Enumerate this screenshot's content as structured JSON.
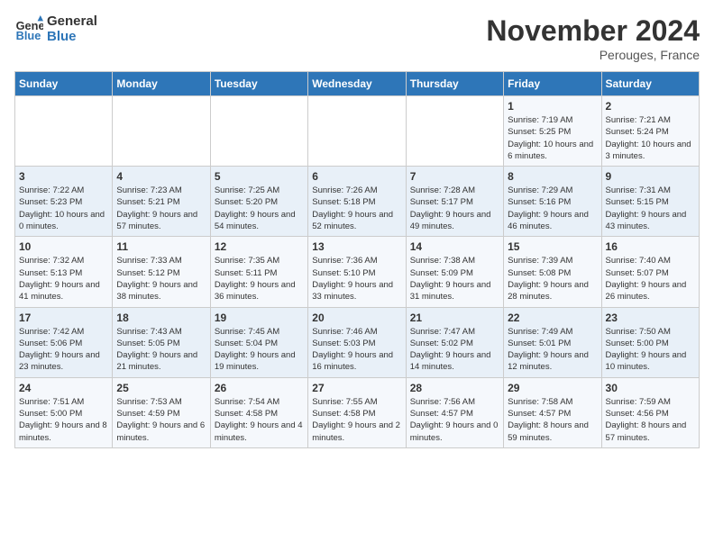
{
  "header": {
    "logo_line1": "General",
    "logo_line2": "Blue",
    "month_title": "November 2024",
    "location": "Perouges, France"
  },
  "weekdays": [
    "Sunday",
    "Monday",
    "Tuesday",
    "Wednesday",
    "Thursday",
    "Friday",
    "Saturday"
  ],
  "weeks": [
    [
      {
        "day": "",
        "info": ""
      },
      {
        "day": "",
        "info": ""
      },
      {
        "day": "",
        "info": ""
      },
      {
        "day": "",
        "info": ""
      },
      {
        "day": "",
        "info": ""
      },
      {
        "day": "1",
        "info": "Sunrise: 7:19 AM\nSunset: 5:25 PM\nDaylight: 10 hours and 6 minutes."
      },
      {
        "day": "2",
        "info": "Sunrise: 7:21 AM\nSunset: 5:24 PM\nDaylight: 10 hours and 3 minutes."
      }
    ],
    [
      {
        "day": "3",
        "info": "Sunrise: 7:22 AM\nSunset: 5:23 PM\nDaylight: 10 hours and 0 minutes."
      },
      {
        "day": "4",
        "info": "Sunrise: 7:23 AM\nSunset: 5:21 PM\nDaylight: 9 hours and 57 minutes."
      },
      {
        "day": "5",
        "info": "Sunrise: 7:25 AM\nSunset: 5:20 PM\nDaylight: 9 hours and 54 minutes."
      },
      {
        "day": "6",
        "info": "Sunrise: 7:26 AM\nSunset: 5:18 PM\nDaylight: 9 hours and 52 minutes."
      },
      {
        "day": "7",
        "info": "Sunrise: 7:28 AM\nSunset: 5:17 PM\nDaylight: 9 hours and 49 minutes."
      },
      {
        "day": "8",
        "info": "Sunrise: 7:29 AM\nSunset: 5:16 PM\nDaylight: 9 hours and 46 minutes."
      },
      {
        "day": "9",
        "info": "Sunrise: 7:31 AM\nSunset: 5:15 PM\nDaylight: 9 hours and 43 minutes."
      }
    ],
    [
      {
        "day": "10",
        "info": "Sunrise: 7:32 AM\nSunset: 5:13 PM\nDaylight: 9 hours and 41 minutes."
      },
      {
        "day": "11",
        "info": "Sunrise: 7:33 AM\nSunset: 5:12 PM\nDaylight: 9 hours and 38 minutes."
      },
      {
        "day": "12",
        "info": "Sunrise: 7:35 AM\nSunset: 5:11 PM\nDaylight: 9 hours and 36 minutes."
      },
      {
        "day": "13",
        "info": "Sunrise: 7:36 AM\nSunset: 5:10 PM\nDaylight: 9 hours and 33 minutes."
      },
      {
        "day": "14",
        "info": "Sunrise: 7:38 AM\nSunset: 5:09 PM\nDaylight: 9 hours and 31 minutes."
      },
      {
        "day": "15",
        "info": "Sunrise: 7:39 AM\nSunset: 5:08 PM\nDaylight: 9 hours and 28 minutes."
      },
      {
        "day": "16",
        "info": "Sunrise: 7:40 AM\nSunset: 5:07 PM\nDaylight: 9 hours and 26 minutes."
      }
    ],
    [
      {
        "day": "17",
        "info": "Sunrise: 7:42 AM\nSunset: 5:06 PM\nDaylight: 9 hours and 23 minutes."
      },
      {
        "day": "18",
        "info": "Sunrise: 7:43 AM\nSunset: 5:05 PM\nDaylight: 9 hours and 21 minutes."
      },
      {
        "day": "19",
        "info": "Sunrise: 7:45 AM\nSunset: 5:04 PM\nDaylight: 9 hours and 19 minutes."
      },
      {
        "day": "20",
        "info": "Sunrise: 7:46 AM\nSunset: 5:03 PM\nDaylight: 9 hours and 16 minutes."
      },
      {
        "day": "21",
        "info": "Sunrise: 7:47 AM\nSunset: 5:02 PM\nDaylight: 9 hours and 14 minutes."
      },
      {
        "day": "22",
        "info": "Sunrise: 7:49 AM\nSunset: 5:01 PM\nDaylight: 9 hours and 12 minutes."
      },
      {
        "day": "23",
        "info": "Sunrise: 7:50 AM\nSunset: 5:00 PM\nDaylight: 9 hours and 10 minutes."
      }
    ],
    [
      {
        "day": "24",
        "info": "Sunrise: 7:51 AM\nSunset: 5:00 PM\nDaylight: 9 hours and 8 minutes."
      },
      {
        "day": "25",
        "info": "Sunrise: 7:53 AM\nSunset: 4:59 PM\nDaylight: 9 hours and 6 minutes."
      },
      {
        "day": "26",
        "info": "Sunrise: 7:54 AM\nSunset: 4:58 PM\nDaylight: 9 hours and 4 minutes."
      },
      {
        "day": "27",
        "info": "Sunrise: 7:55 AM\nSunset: 4:58 PM\nDaylight: 9 hours and 2 minutes."
      },
      {
        "day": "28",
        "info": "Sunrise: 7:56 AM\nSunset: 4:57 PM\nDaylight: 9 hours and 0 minutes."
      },
      {
        "day": "29",
        "info": "Sunrise: 7:58 AM\nSunset: 4:57 PM\nDaylight: 8 hours and 59 minutes."
      },
      {
        "day": "30",
        "info": "Sunrise: 7:59 AM\nSunset: 4:56 PM\nDaylight: 8 hours and 57 minutes."
      }
    ]
  ]
}
